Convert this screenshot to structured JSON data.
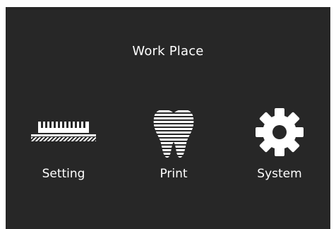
{
  "window": {
    "title": "Work Place"
  },
  "menu": {
    "items": [
      {
        "label": "Setting",
        "icon": "printer-platform-icon"
      },
      {
        "label": "Print",
        "icon": "tooth-icon"
      },
      {
        "label": "System",
        "icon": "gear-icon"
      }
    ]
  },
  "colors": {
    "background": "#272727",
    "foreground": "#ffffff"
  }
}
